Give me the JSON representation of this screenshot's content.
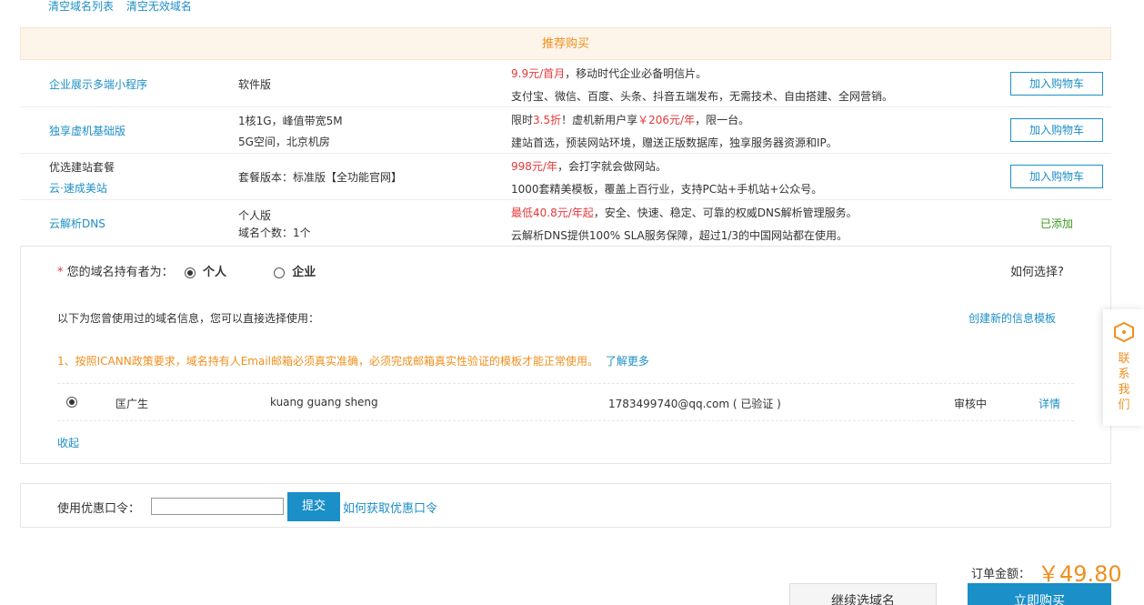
{
  "top_links": [
    "清空域名列表",
    "清空无效域名"
  ],
  "recommend": {
    "title": "推荐购买",
    "rows": [
      {
        "name_lines": [
          "企业展示多端小程序"
        ],
        "name_style": [
          "link"
        ],
        "spec_lines": [
          "软件版"
        ],
        "desc_line1_red": "9.9元/首月",
        "desc_line1_rest": "，移动时代企业必备明信片。",
        "desc_line2": "支付宝、微信、百度、头条、抖音五端发布，无需技术、自由搭建、全网营销。",
        "action": "加入购物车"
      },
      {
        "name_lines": [
          "独享虚机基础版"
        ],
        "name_style": [
          "link"
        ],
        "spec_lines": [
          "1核1G，峰值带宽5M",
          "5G空间，北京机房"
        ],
        "desc_line1_pre": "限时",
        "desc_line1_red": "3.5折",
        "desc_line1_mid": "！虚机新用户享",
        "desc_line1_red2": "￥206元/年",
        "desc_line1_rest": "，限一台。",
        "desc_line2": "建站首选，预装网站环境，赠送正版数据库，独享服务器资源和IP。",
        "action": "加入购物车"
      },
      {
        "name_lines": [
          "优选建站套餐",
          "云·速成美站"
        ],
        "name_style": [
          "plain",
          "link"
        ],
        "spec_lines": [
          "套餐版本：标准版【全功能官网】"
        ],
        "desc_line1_red": "998元/年",
        "desc_line1_rest": "，会打字就会做网站。",
        "desc_line2": "1000套精美模板，覆盖上百行业，支持PC站+手机站+公众号。",
        "action": "加入购物车"
      },
      {
        "name_lines": [
          "云解析DNS"
        ],
        "name_style": [
          "link"
        ],
        "spec_lines": [
          "个人版",
          "域名个数：1个"
        ],
        "desc_line1_red": "最低40.8元/年起",
        "desc_line1_rest": "，安全、快速、稳定、可靠的权威DNS解析管理服务。",
        "desc_line2": "云解析DNS提供100% SLA服务保障，超过1/3的中国网站都在使用。",
        "status": "已添加"
      }
    ]
  },
  "holder": {
    "required_mark": "*",
    "label": "您的域名持有者为：",
    "options": [
      "个人",
      "企业"
    ],
    "selected": "个人",
    "help_link": "如何选择?",
    "intro": "以下为您曾使用过的域名信息，您可以直接选择使用：",
    "create_link": "创建新的信息模板",
    "notice": "1、按照ICANN政策要求，域名持有人Email邮箱必须真实准确，必须完成邮箱真实性验证的模板才能正常使用。",
    "notice_link": "了解更多",
    "template": {
      "name_cn": "匡广生",
      "name_en": "kuang guang sheng",
      "email": "1783499740@qq.com ( 已验证 )",
      "status": "审核中",
      "detail_link": "详情"
    },
    "collapse_link": "收起"
  },
  "coupon": {
    "label": "使用优惠口令：",
    "input_value": "",
    "submit": "提交",
    "help_link": "如何获取优惠口令"
  },
  "side": {
    "text": "联系我们"
  },
  "footer": {
    "total_label": "订单金额：",
    "total_value": "￥49.80",
    "continue_button": "继续选域名",
    "buy_button": "立即购买"
  },
  "colors": {
    "link": "#1d8fc6",
    "accent": "#f08f1d",
    "price_red": "#e4393c",
    "primary": "#1a8fc8",
    "added_green": "#3a9a1e"
  }
}
